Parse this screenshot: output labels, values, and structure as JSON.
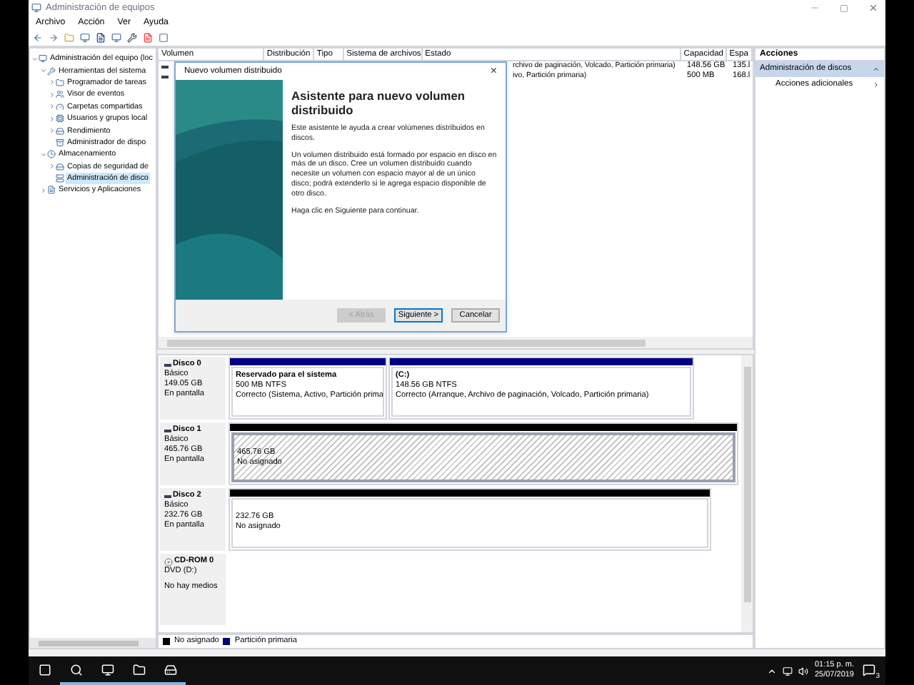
{
  "window": {
    "title": "Administración de equipos"
  },
  "menu": [
    "Archivo",
    "Acción",
    "Ver",
    "Ayuda"
  ],
  "tree": [
    {
      "label": "Administración del equipo (loc",
      "expanded": true,
      "selected": false,
      "children": [
        {
          "label": "Herramientas del sistema",
          "expanded": true,
          "selected": false,
          "children": [
            {
              "label": "Programador de tareas",
              "expanded": false,
              "selected": false
            },
            {
              "label": "Visor de eventos",
              "expanded": false,
              "selected": false
            },
            {
              "label": "Carpetas compartidas",
              "expanded": false,
              "selected": false
            },
            {
              "label": "Usuarios y grupos local",
              "expanded": false,
              "selected": false
            },
            {
              "label": "Rendimiento",
              "expanded": false,
              "selected": false
            },
            {
              "label": "Administrador de dispo",
              "selected": false
            }
          ]
        },
        {
          "label": "Almacenamiento",
          "expanded": true,
          "selected": false,
          "children": [
            {
              "label": "Copias de seguridad de",
              "expanded": false,
              "selected": false
            },
            {
              "label": "Administración de disco",
              "selected": true
            }
          ]
        },
        {
          "label": "Servicios y Aplicaciones",
          "expanded": false,
          "selected": false
        }
      ]
    }
  ],
  "volume_table": {
    "columns": [
      "Volumen",
      "Distribución",
      "Tipo",
      "Sistema de archivos",
      "Estado",
      "Capacidad",
      "Espa"
    ],
    "rows": [
      {
        "status": "rchivo de paginación, Volcado, Partición primaria)",
        "capacity": "148.56 GB",
        "free": "135.l"
      },
      {
        "status": "ivo, Partición primaria)",
        "capacity": "500 MB",
        "free": "168.l"
      }
    ]
  },
  "dialog": {
    "title": "Nuevo volumen distribuido",
    "close": "×",
    "heading": "Asistente para nuevo volumen distribuido",
    "paragraphs": [
      "Este asistente le ayuda a crear volúmenes distribuidos en discos.",
      "Un volumen distribuido está formado por espacio en disco en más de un disco. Cree un volumen distribuido cuando necesite un volumen con espacio mayor al de un único disco; podrá extenderlo si le agrega espacio disponible de otro disco.",
      "Haga clic en Siguiente para continuar."
    ],
    "buttons": [
      {
        "label": "< Atrás",
        "disabled": true,
        "selected": false
      },
      {
        "label": "Siguiente >",
        "disabled": false,
        "selected": true
      },
      {
        "label": "Cancelar",
        "disabled": false,
        "selected": false
      }
    ]
  },
  "disks": [
    {
      "kind": "disk",
      "name": "Disco 0",
      "type": "Básico",
      "size": "149.05 GB",
      "status": "En pantalla",
      "partitions": [
        {
          "kind": "primary",
          "selected": false,
          "title": "Reservado para el sistema",
          "size": "500 MB NTFS",
          "status": "Correcto (Sistema, Activo, Partición prima"
        },
        {
          "kind": "primary",
          "selected": false,
          "title": "(C:)",
          "size": "148.56 GB NTFS",
          "status": "Correcto (Arranque, Archivo de paginación, Volcado, Partición primaria)"
        }
      ]
    },
    {
      "kind": "disk",
      "name": "Disco 1",
      "type": "Básico",
      "size": "465.76 GB",
      "status": "En pantalla",
      "partitions": [
        {
          "kind": "unallocated",
          "selected": true,
          "size": "465.76 GB",
          "status": "No asignado"
        }
      ]
    },
    {
      "kind": "disk",
      "name": "Disco 2",
      "type": "Básico",
      "size": "232.76 GB",
      "status": "En pantalla",
      "partitions": [
        {
          "kind": "unallocated",
          "selected": false,
          "size": "232.76 GB",
          "status": "No asignado"
        }
      ]
    },
    {
      "kind": "cdrom",
      "name": "CD-ROM 0",
      "type": "DVD (D:)",
      "status": "No hay medios"
    }
  ],
  "legend": [
    {
      "label": "No asignado",
      "color": "#000000"
    },
    {
      "label": "Partición primaria",
      "color": "#000080"
    }
  ],
  "actions": {
    "title": "Acciones",
    "items": [
      {
        "label": "Administración de discos",
        "kind": "section",
        "expanded": true
      },
      {
        "label": "Acciones adicionales",
        "kind": "submenu"
      }
    ]
  },
  "taskbar": {
    "apps": [
      {
        "running": false
      },
      {
        "running": true
      },
      {
        "running": true
      },
      {
        "running": true
      },
      {
        "running": true
      }
    ],
    "time": "01:15 p. m.",
    "date": "25/07/2019",
    "notifications": "3"
  }
}
